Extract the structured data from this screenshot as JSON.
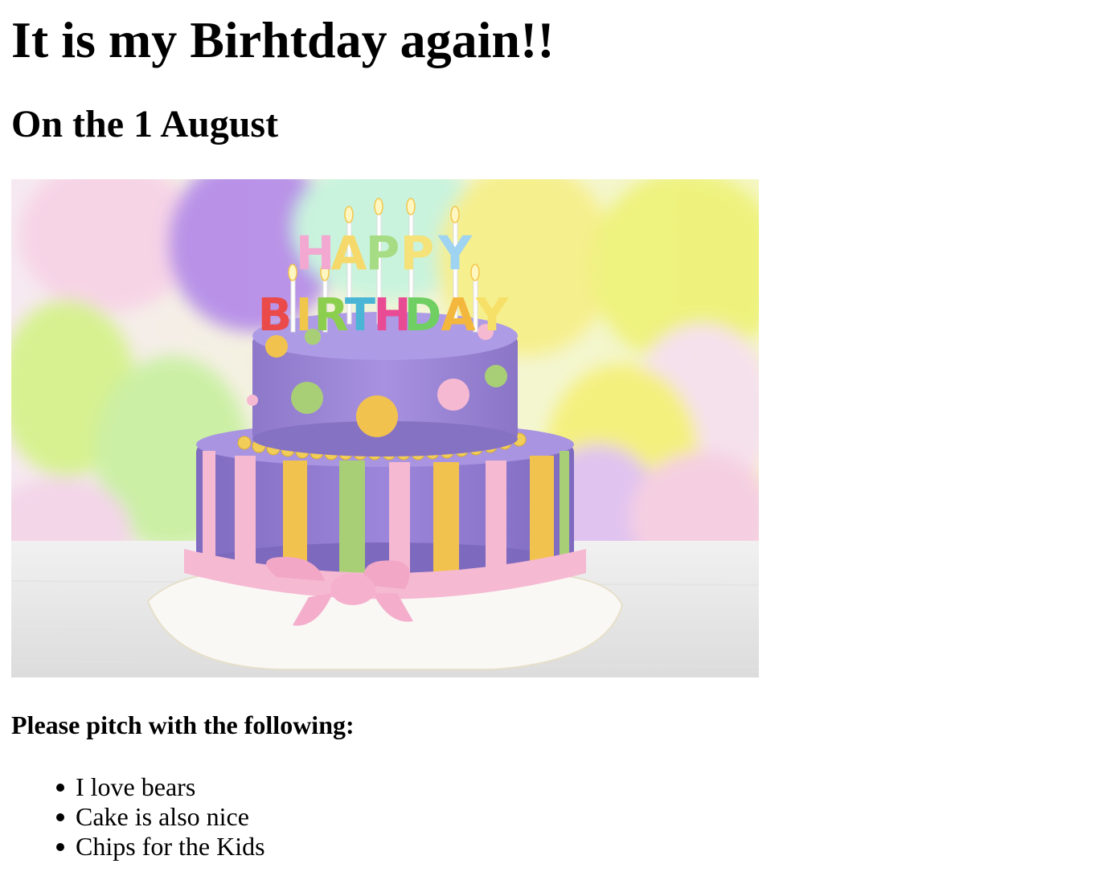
{
  "page": {
    "heading": "It is my Birhtday again!!",
    "subheading": "On the 1 August",
    "list_heading": "Please pitch with the following:",
    "list_items": [
      {
        "text": "I love bears"
      },
      {
        "text": "Cake is also nice"
      },
      {
        "text": "Chips for the Kids"
      }
    ]
  },
  "image": {
    "subject": "birthday-cake-photo",
    "cake_topper_text": {
      "top": "HAPPY",
      "bottom": "BIRTHDAY"
    },
    "colors": {
      "cake_purple": "#9c84d6",
      "stripe_yellow": "#f2c24f",
      "stripe_green": "#a9cf76",
      "ribbon_pink": "#f6b9d2",
      "balloon_yellow": "#f4f07a",
      "balloon_purple": "#b68ee8"
    }
  }
}
